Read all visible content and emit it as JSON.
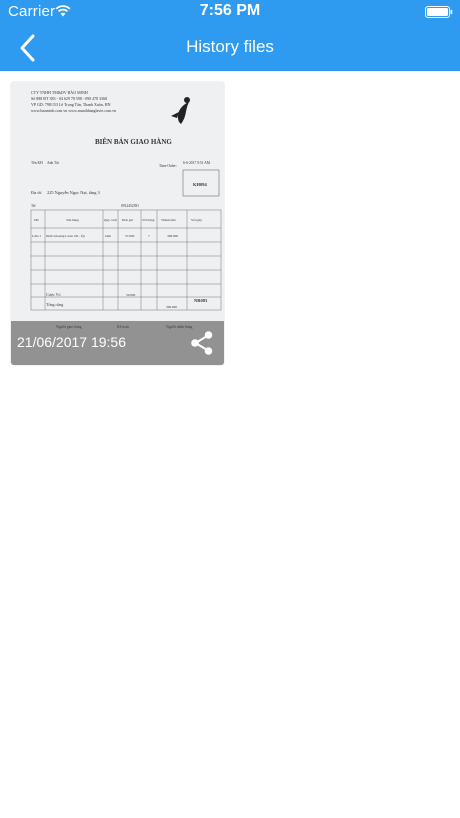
{
  "status_bar": {
    "carrier": "Carrier",
    "time": "7:56 PM"
  },
  "nav": {
    "title": "History files",
    "back_icon": "chevron-left-icon"
  },
  "files": [
    {
      "timestamp": "21/06/2017 19:56",
      "share_icon": "share-icon",
      "thumbnail": {
        "company_lines": [
          "CTY TNHH TM&DV BẢO MINH",
          "Số 888 ĐT 383 - 04 629 78 598 - 090 478 3368",
          "VP GD: 798/153 Lê Trọng Tấn, Thanh Xuân, HN",
          "www.baominh.com.vn  www.muathhanglavie.com.vn"
        ],
        "document_title": "BIÊN BẢN GIAO HÀNG",
        "customer_label": "Tên KH",
        "customer": "Anh Tài",
        "time_order_label": "Time Order:",
        "time_order": "6-6-2017 9:51 AM",
        "address_label": "Địa chỉ",
        "address": "225 Nguyễn Ngọc Nại, tầng 3",
        "phone_label": "Tel",
        "phone": "0912452391",
        "code": "KH094",
        "col_headers": [
          "Mã",
          "Tên hàng",
          "Quy cách",
          "Đơn giá",
          "Số lượng",
          "Thành tiền",
          "Số ngày"
        ],
        "item_code": "LAV-1",
        "item_name": "Nước khoáng Lavie 19l - Úp",
        "item_unit": "bình",
        "item_price": "57.000",
        "item_qty": "7",
        "item_total": "399.000",
        "shell_label": "Cược Vỏ",
        "shell_value": "50.000",
        "total_label": "Tổng cộng",
        "total_value": "399.000",
        "code2": "NR083",
        "sign_left": "Người giao hàng",
        "sign_mid": "Kế toán",
        "sign_right": "Người nhận hàng"
      }
    }
  ]
}
